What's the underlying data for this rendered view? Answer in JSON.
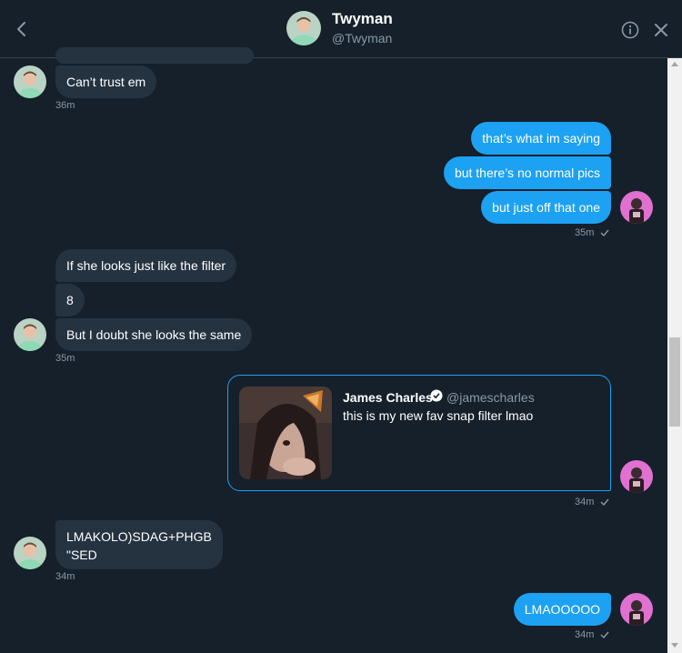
{
  "header": {
    "name": "Twyman",
    "handle": "@Twyman"
  },
  "messages": {
    "m1": "Can’t trust em",
    "t1": "36m",
    "m2": "that’s what im saying",
    "m3": "but there’s no normal pics",
    "m4": "but just off that one",
    "t2": "35m",
    "m5": "If she looks just like the filter",
    "m6": "8",
    "m7": "But I doubt she looks the same",
    "t3": "35m",
    "t4": "34m",
    "m8": "LMAKOLO)SDAG+PHGB\n\"SED",
    "t5": "34m",
    "m9": "LMAOOOOO",
    "t6": "34m"
  },
  "tweet": {
    "author": "James Charles",
    "handle": "@jamescharles",
    "text": "this is my new fav snap filter lmao"
  },
  "colors": {
    "background": "#15202b",
    "accent": "#1da1f2",
    "incoming_bubble": "#253341",
    "muted": "#8899a6"
  },
  "icons": {
    "back": "chevron-left-icon",
    "info": "info-icon",
    "close": "close-icon",
    "read": "checkmark-icon",
    "verified": "verified-badge-icon"
  }
}
